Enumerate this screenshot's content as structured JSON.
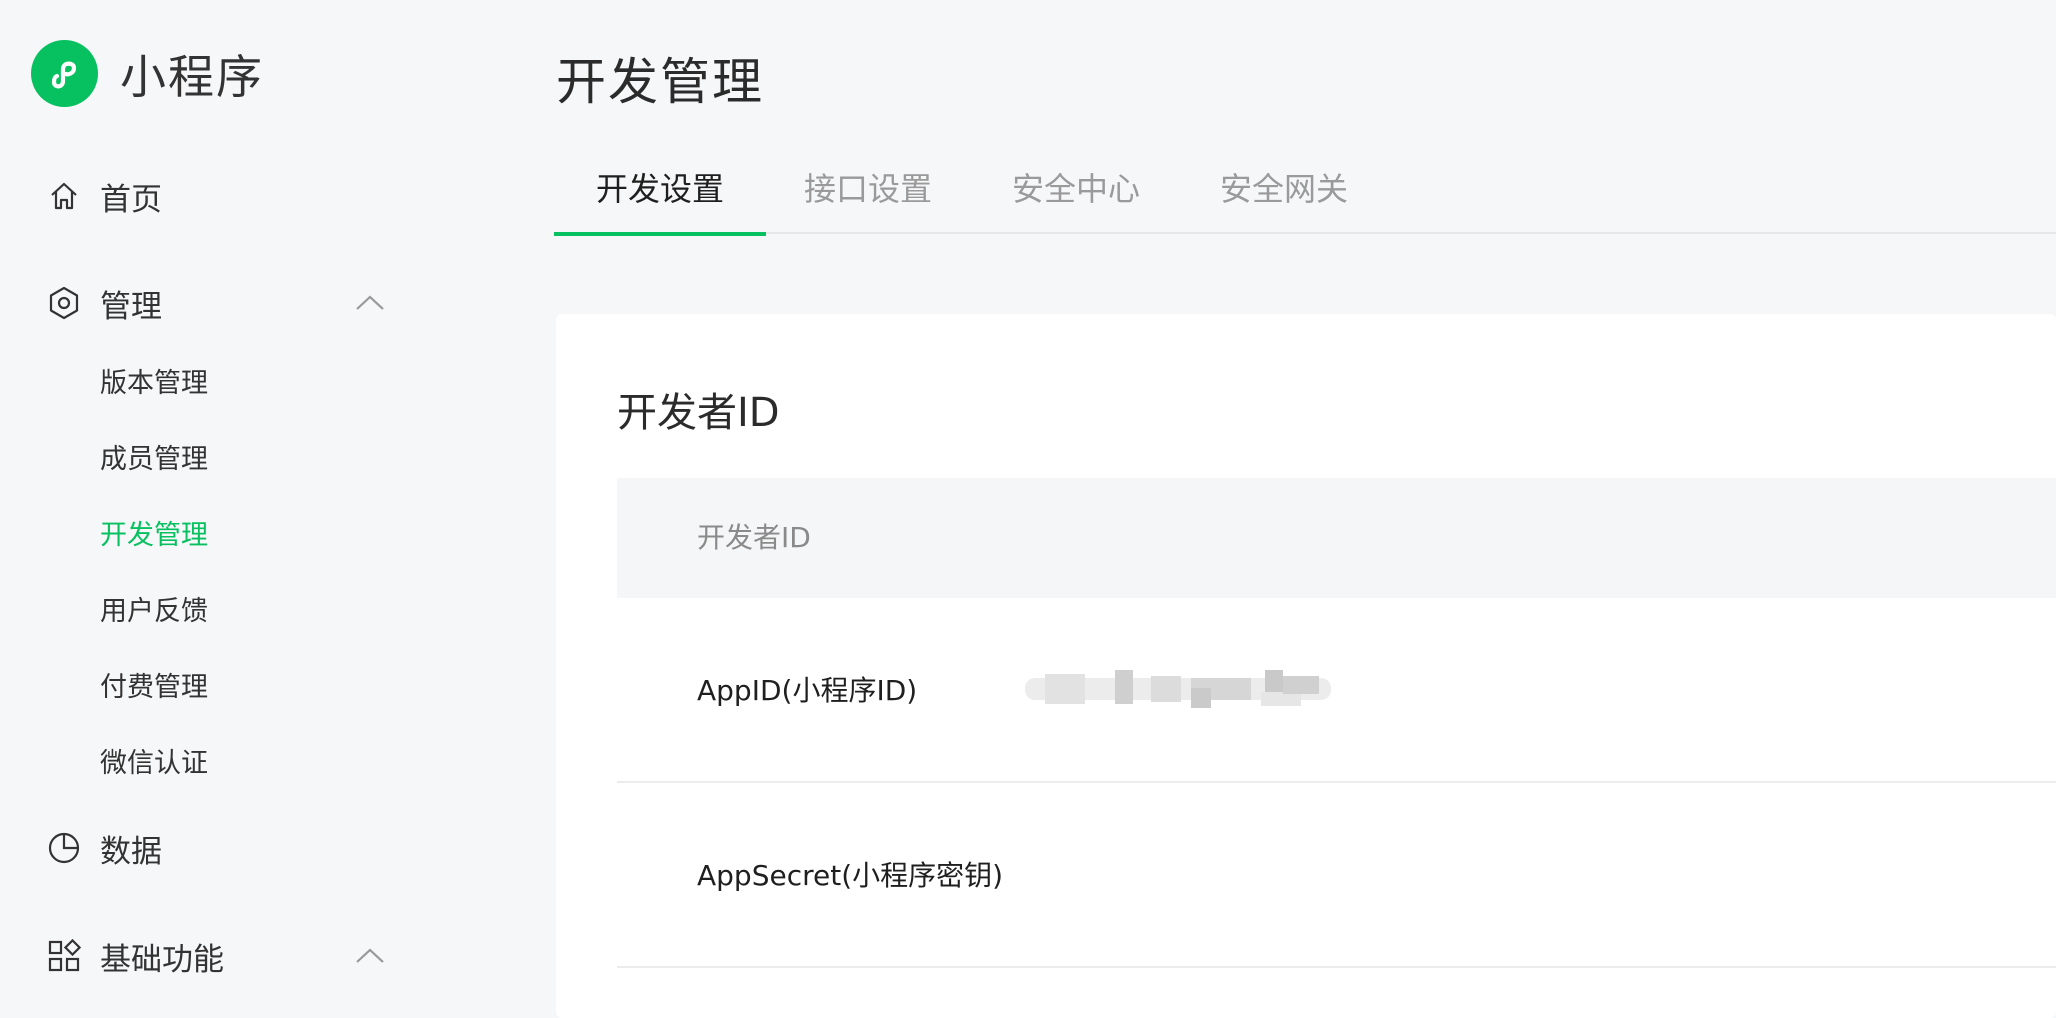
{
  "app": {
    "name": "小程序",
    "brand_color": "#07c160"
  },
  "sidebar": {
    "items": [
      {
        "label": "首页",
        "icon": "home-icon"
      },
      {
        "label": "管理",
        "icon": "hexagon-settings-icon",
        "expanded": true,
        "children": [
          {
            "label": "版本管理"
          },
          {
            "label": "成员管理"
          },
          {
            "label": "开发管理",
            "active": true
          },
          {
            "label": "用户反馈"
          },
          {
            "label": "付费管理"
          },
          {
            "label": "微信认证"
          }
        ]
      },
      {
        "label": "数据",
        "icon": "pie-chart-icon"
      },
      {
        "label": "基础功能",
        "icon": "grid-apps-icon",
        "expanded": true
      }
    ]
  },
  "main": {
    "title": "开发管理",
    "tabs": [
      {
        "label": "开发设置",
        "active": true
      },
      {
        "label": "接口设置"
      },
      {
        "label": "安全中心"
      },
      {
        "label": "安全网关"
      }
    ],
    "section": {
      "title": "开发者ID",
      "header": "开发者ID",
      "rows": [
        {
          "label": "AppID(小程序ID)"
        },
        {
          "label": "AppSecret(小程序密钥)"
        }
      ]
    }
  }
}
